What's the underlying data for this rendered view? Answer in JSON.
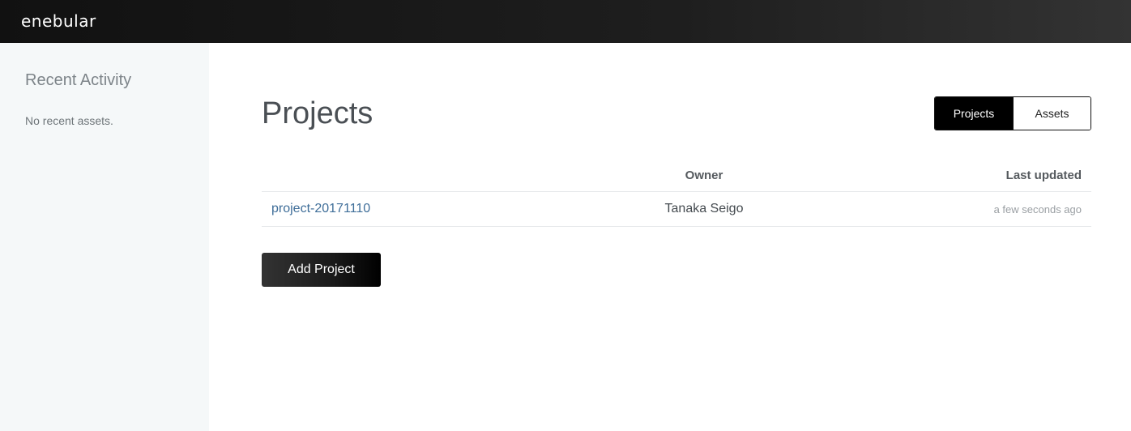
{
  "header": {
    "logo_text": "enebular"
  },
  "sidebar": {
    "title": "Recent Activity",
    "empty_message": "No recent assets."
  },
  "main": {
    "page_title": "Projects",
    "view_toggle": {
      "projects_label": "Projects",
      "assets_label": "Assets",
      "selected": "Projects"
    },
    "table": {
      "columns": [
        "",
        "Owner",
        "Last updated"
      ],
      "rows": [
        {
          "name": "project-20171110",
          "owner": "Tanaka Seigo",
          "last_updated": "a few seconds ago"
        }
      ]
    },
    "add_button_label": "Add Project"
  },
  "colors": {
    "topbar": "#111111",
    "sidebar_bg": "#f5f8f9",
    "link": "#3f6e99",
    "active_toggle": "#000000"
  }
}
